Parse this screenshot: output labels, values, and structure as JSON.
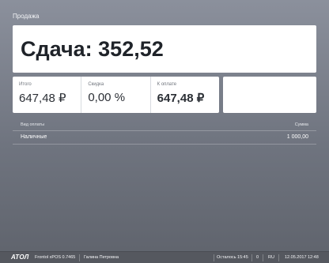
{
  "header": {
    "title": "Продажа"
  },
  "change": {
    "text": "Сдача: 352,52"
  },
  "totals": {
    "total_label": "Итого",
    "total_value": "647,48 ₽",
    "discount_label": "Скидка",
    "discount_value": "0,00 %",
    "due_label": "К оплате",
    "due_value": "647,48 ₽"
  },
  "payments": {
    "col_type": "Вид оплаты",
    "col_sum": "Сумма",
    "rows": [
      {
        "type": "Наличные",
        "sum": "1 000,00"
      }
    ]
  },
  "status_bar": {
    "logo": "АТОЛ",
    "app_version": "Frontol xPOS 0.7465",
    "cashier": "Галина Петровна",
    "remaining": "Осталось 15:45",
    "counter": "0",
    "language": "RU",
    "date": "12.05.2017",
    "time": "12:48"
  }
}
